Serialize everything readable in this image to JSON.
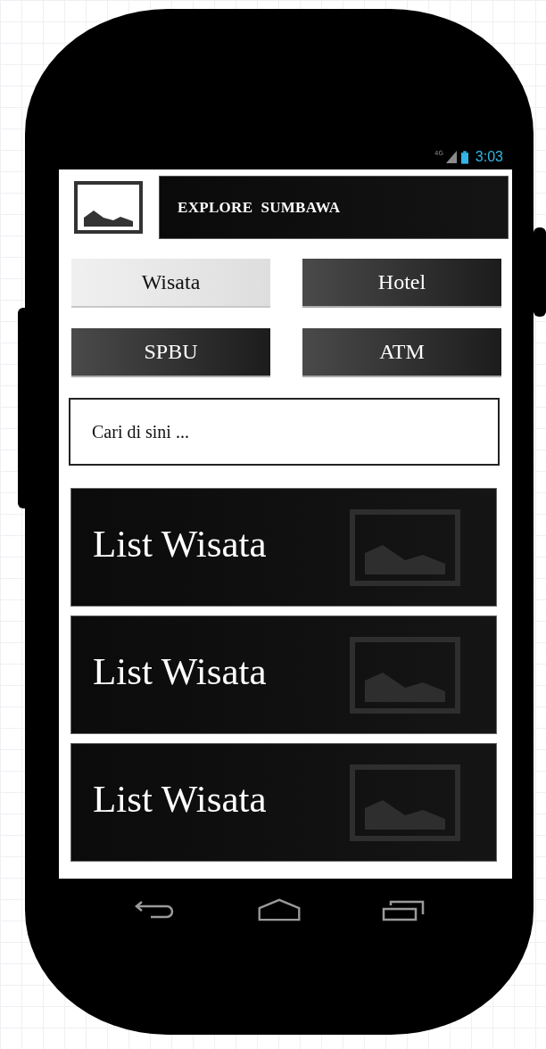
{
  "status_bar": {
    "network": "4G",
    "time": "3:03"
  },
  "app_bar": {
    "title": "EXPLORE  SUMBAWA"
  },
  "tabs": [
    {
      "label": "Wisata",
      "selected": true
    },
    {
      "label": "Hotel",
      "selected": false
    },
    {
      "label": "SPBU",
      "selected": false
    },
    {
      "label": "ATM",
      "selected": false
    }
  ],
  "search": {
    "placeholder": "Cari di sini ..."
  },
  "list": [
    {
      "title": "List Wisata"
    },
    {
      "title": "List Wisata"
    },
    {
      "title": "List Wisata"
    }
  ]
}
